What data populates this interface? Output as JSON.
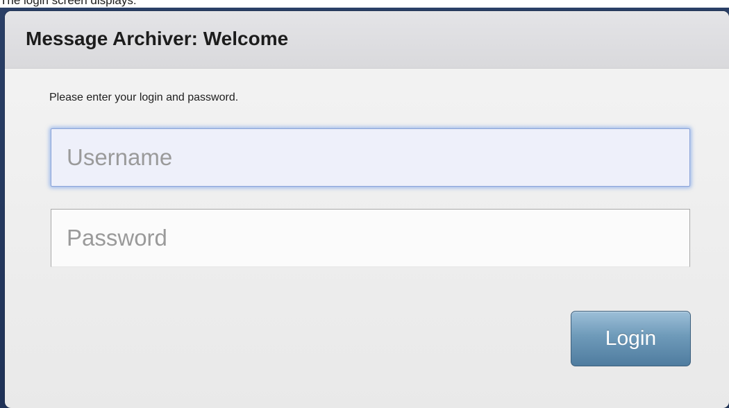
{
  "caption": "The login screen displays:",
  "dialog": {
    "title": "Message Archiver: Welcome",
    "instructions": "Please enter your login and password.",
    "username_placeholder": "Username",
    "password_placeholder": "Password",
    "login_label": "Login"
  },
  "colors": {
    "backdrop": "#243a60",
    "focus_glow": "#5a8ce6",
    "button": "#6e9ab9"
  }
}
